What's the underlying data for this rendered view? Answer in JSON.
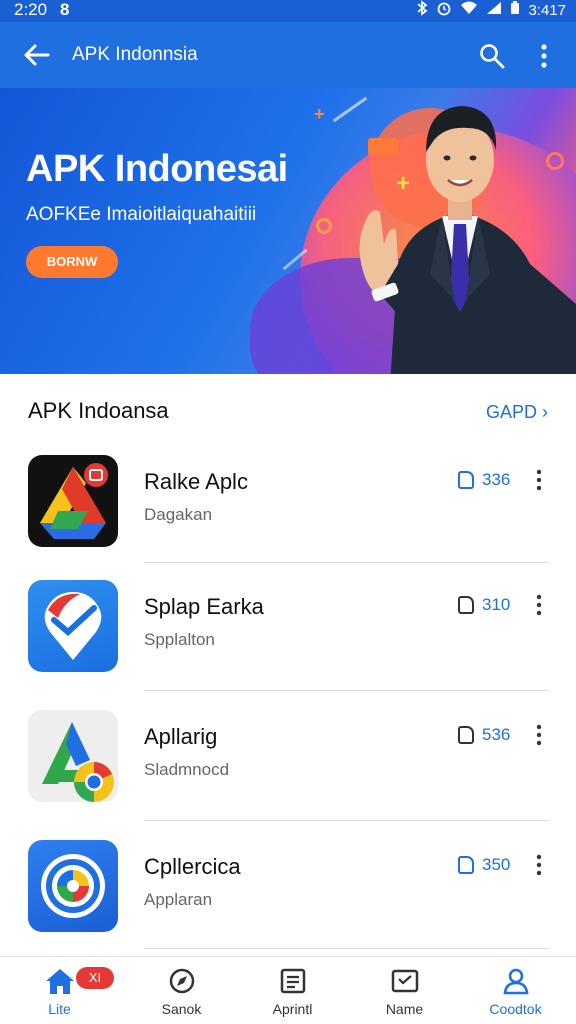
{
  "status_bar": {
    "time": "2:20",
    "time_extra": "8",
    "battery": "3:417"
  },
  "app_bar": {
    "title": "APK Indonnsia",
    "back_icon": "arrow-left-icon",
    "search_icon": "search-icon",
    "more_icon": "more-vertical-icon"
  },
  "banner": {
    "headline": "APK Indonesai",
    "subtitle": "AOFKEe Imaioitlaiquahaitiii",
    "cta": "BORNW",
    "colors": {
      "primary": "#1f6fe0",
      "accent": "#ff7a2e"
    }
  },
  "section": {
    "title": "APK Indoansa",
    "link": "GAPD"
  },
  "apps": [
    {
      "name": "Ralke Aplc",
      "subtitle": "Dagakan",
      "size": "336",
      "icon": "drive-like-app-icon"
    },
    {
      "name": "Splap Earka",
      "subtitle": "Spplalton",
      "size": "310",
      "icon": "location-pin-app-icon"
    },
    {
      "name": "Apllarig",
      "subtitle": "Sladmnocd",
      "size": "536",
      "icon": "chrome-like-app-icon"
    },
    {
      "name": "Cpllercica",
      "subtitle": "Applaran",
      "size": "350",
      "icon": "circle-app-icon"
    }
  ],
  "bottom_nav": {
    "items": [
      {
        "label": "Lite",
        "icon": "home-icon",
        "badge": "XI",
        "active": true
      },
      {
        "label": "Sanok",
        "icon": "compass-icon",
        "active": false
      },
      {
        "label": "Aprintl",
        "icon": "list-icon",
        "active": false
      },
      {
        "label": "Name",
        "icon": "inbox-icon",
        "active": false
      },
      {
        "label": "Coodtok",
        "icon": "person-icon",
        "active": true
      }
    ]
  }
}
